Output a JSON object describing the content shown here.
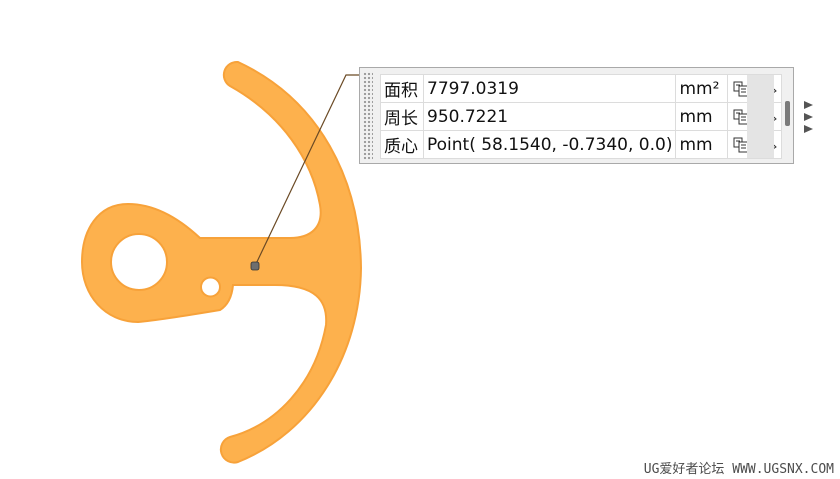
{
  "measurements": [
    {
      "label": "面积",
      "value": "7797.0319",
      "unit": "mm²"
    },
    {
      "label": "周长",
      "value": "950.7221",
      "unit": "mm"
    },
    {
      "label": "质心",
      "value": "Point( 58.1540, -0.7340, 0.0)",
      "unit": "mm"
    }
  ],
  "row_icons": [
    "export-values-icon",
    "show-hide-icon"
  ],
  "colors": {
    "part_fill": "#fdb14d",
    "part_edge": "#f7a23a",
    "leader_line": "#6b4a25",
    "panel_bg": "#f0f0f0"
  },
  "watermark": "UG爱好者论坛 WWW.UGSNX.COM"
}
